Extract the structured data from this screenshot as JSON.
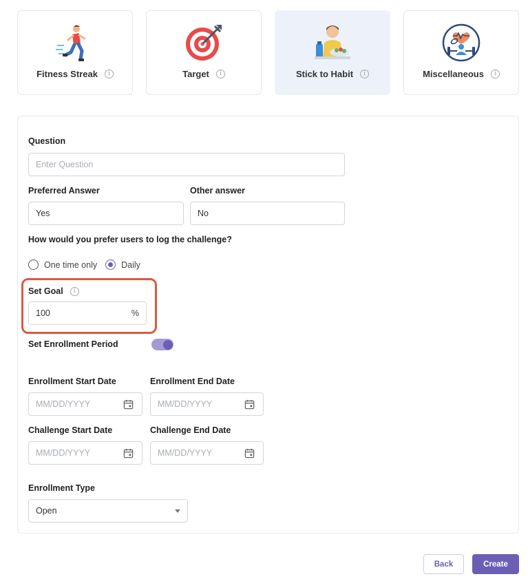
{
  "categories": [
    {
      "label": "Fitness Streak",
      "icon": "runner-icon",
      "selected": false
    },
    {
      "label": "Target",
      "icon": "target-icon",
      "selected": false
    },
    {
      "label": "Stick to Habit",
      "icon": "habit-icon",
      "selected": true
    },
    {
      "label": "Miscellaneous",
      "icon": "fitness-misc-icon",
      "selected": false
    }
  ],
  "form": {
    "question_label": "Question",
    "question_placeholder": "Enter Question",
    "preferred_label": "Preferred Answer",
    "preferred_value": "Yes",
    "other_label": "Other answer",
    "other_value": "No",
    "log_label": "How would you prefer users to log the challenge?",
    "log_options": [
      {
        "label": "One time only",
        "selected": false
      },
      {
        "label": "Daily",
        "selected": true
      }
    ],
    "goal_label": "Set Goal",
    "goal_value": "100",
    "goal_unit": "%",
    "enrollment_period_label": "Set Enrollment Period",
    "enrollment_period_on": true,
    "enroll_start_label": "Enrollment Start Date",
    "enroll_end_label": "Enrollment End Date",
    "challenge_start_label": "Challenge Start Date",
    "challenge_end_label": "Challenge End Date",
    "date_placeholder": "MM/DD/YYYY",
    "enrollment_type_label": "Enrollment Type",
    "enrollment_type_value": "Open"
  },
  "buttons": {
    "back": "Back",
    "create": "Create"
  },
  "colors": {
    "accent": "#6b5fb5",
    "highlight": "#d95a44",
    "selected_card": "#edf2fa"
  }
}
